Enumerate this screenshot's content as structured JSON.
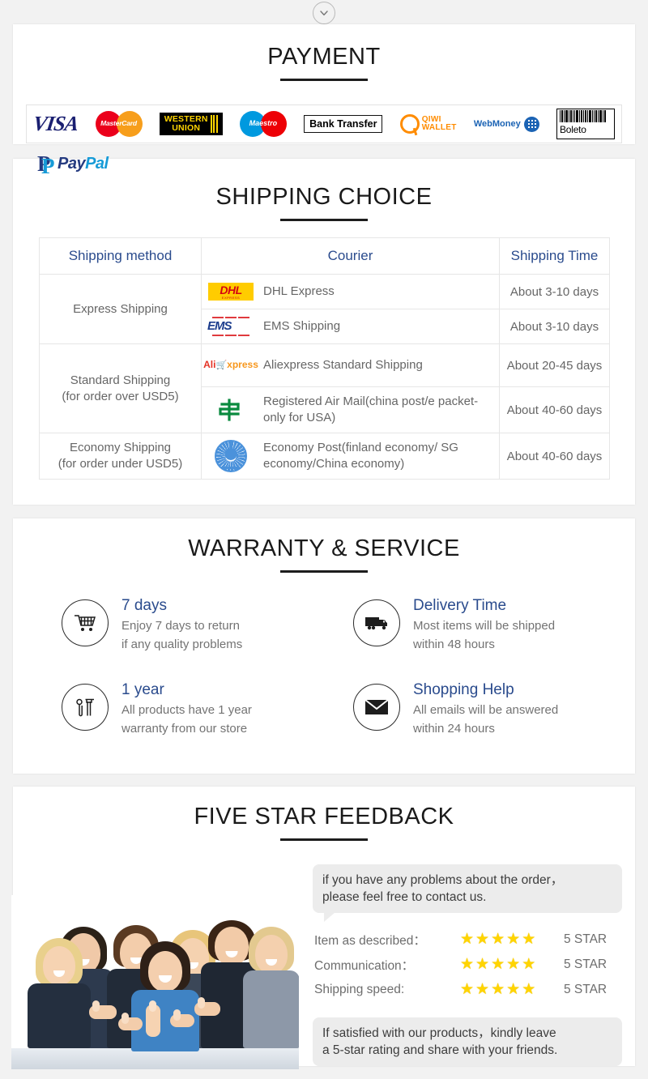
{
  "top": {
    "expand_icon": "chevron-down-icon"
  },
  "payment": {
    "title": "PAYMENT",
    "methods": [
      {
        "name": "visa",
        "label": "VISA"
      },
      {
        "name": "mastercard",
        "label": "MasterCard"
      },
      {
        "name": "western-union",
        "label_top": "WESTERN",
        "label_bottom": "UNION"
      },
      {
        "name": "maestro",
        "label": "Maestro"
      },
      {
        "name": "bank-transfer",
        "label": "Bank Transfer"
      },
      {
        "name": "qiwi-wallet",
        "label_top": "QIWI",
        "label_bottom": "WALLET"
      },
      {
        "name": "webmoney",
        "label": "WebMoney"
      },
      {
        "name": "boleto",
        "label": "Boleto"
      }
    ],
    "paypal": {
      "mark": "P",
      "text_a": "Pay",
      "text_b": "Pal"
    }
  },
  "shipping": {
    "title": "SHIPPING CHOICE",
    "columns": [
      "Shipping method",
      "Courier",
      "Shipping Time"
    ],
    "rows": [
      {
        "method": "Express Shipping",
        "method_note": "",
        "items": [
          {
            "logo": "dhl-logo",
            "courier": "DHL Express",
            "time": "About 3-10 days"
          },
          {
            "logo": "ems-logo",
            "courier": "EMS Shipping",
            "time": "About 3-10 days"
          }
        ]
      },
      {
        "method": "Standard Shipping",
        "method_note": "(for order over USD5)",
        "items": [
          {
            "logo": "aliexpress-logo",
            "courier": "Aliexpress Standard Shipping",
            "time": "About 20-45 days"
          },
          {
            "logo": "china-post-logo",
            "courier": "Registered Air Mail(china post/e packet-only for USA)",
            "time": "About 40-60 days"
          }
        ]
      },
      {
        "method": "Economy Shipping",
        "method_note": "(for order under USD5)",
        "items": [
          {
            "logo": "un-post-logo",
            "courier": "Economy Post(finland economy/ SG economy/China economy)",
            "time": "About 40-60 days"
          }
        ]
      }
    ],
    "logo_text": {
      "dhl_main": "DHL",
      "dhl_sub": "EXPRESS",
      "ems": "EMS",
      "ali_a": "Ali",
      "ali_x": "xpress",
      "china_post": "中"
    }
  },
  "warranty": {
    "title": "WARRANTY & SERVICE",
    "items": [
      {
        "icon": "shopping-cart-icon",
        "heading": "7 days",
        "line1": "Enjoy 7 days to return",
        "line2": "if any quality problems"
      },
      {
        "icon": "delivery-truck-icon",
        "heading": "Delivery Time",
        "line1": "Most items will be shipped",
        "line2": "within 48 hours"
      },
      {
        "icon": "tools-icon",
        "heading": "1 year",
        "line1": "All products have 1 year",
        "line2": "warranty from our store"
      },
      {
        "icon": "envelope-icon",
        "heading": "Shopping Help",
        "line1": "All emails will be answered",
        "line2": "within 24 hours"
      }
    ]
  },
  "feedback": {
    "title": "FIVE STAR FEEDBACK",
    "photo_alt": "happy-customers-thumbs-up-photo",
    "bubble_top_line1": "if you have any problems about the order，",
    "bubble_top_line2": "please feel free to contact us.",
    "ratings": [
      {
        "label": "Item as described：",
        "stars": "★★★★★",
        "value": "5 STAR"
      },
      {
        "label": "Communication：",
        "stars": "★★★★★",
        "value": "5 STAR"
      },
      {
        "label": "Shipping speed:",
        "stars": "★★★★★",
        "value": "5 STAR"
      }
    ],
    "bubble_bottom_line1": "If satisfied with our products，kindly leave",
    "bubble_bottom_line2": "a 5-star rating and share with your friends."
  },
  "colors": {
    "page_bg": "#f2f2f2",
    "panel_bg": "#ffffff",
    "heading": "#1a1a1a",
    "accent_blue": "#2a4b8d",
    "body_text": "#737373",
    "star_yellow": "#ffd400",
    "bubble_bg": "#ececec"
  }
}
